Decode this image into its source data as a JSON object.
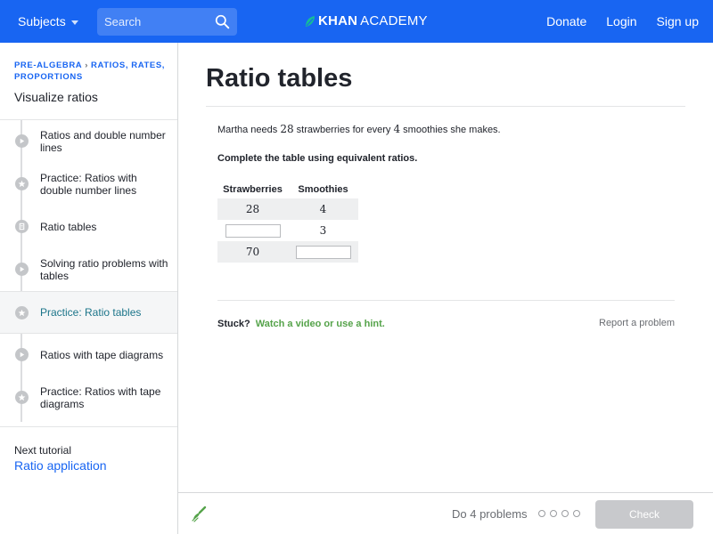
{
  "nav": {
    "subjects": "Subjects",
    "search_placeholder": "Search",
    "logo_bold": "KHAN",
    "logo_light": "ACADEMY",
    "donate": "Donate",
    "login": "Login",
    "signup": "Sign up",
    "bar_color": "#1865f2"
  },
  "sidebar": {
    "breadcrumb_1": "Pre-algebra",
    "breadcrumb_2": "Ratios, rates, proportions",
    "unit_title": "Visualize ratios",
    "items": [
      {
        "label": "Ratios and double number lines",
        "icon": "play-icon",
        "active": false
      },
      {
        "label": "Practice: Ratios with double number lines",
        "icon": "star-icon",
        "active": false
      },
      {
        "label": "Ratio tables",
        "icon": "article-icon",
        "active": false
      },
      {
        "label": "Solving ratio problems with tables",
        "icon": "play-icon",
        "active": false
      },
      {
        "label": "Practice: Ratio tables",
        "icon": "star-icon",
        "active": true
      },
      {
        "label": "Ratios with tape diagrams",
        "icon": "play-icon",
        "active": false
      },
      {
        "label": "Practice: Ratios with tape diagrams",
        "icon": "star-icon",
        "active": false
      }
    ],
    "next_label": "Next tutorial",
    "next_link": "Ratio application"
  },
  "main": {
    "title": "Ratio tables",
    "problem_pre": "Martha needs ",
    "problem_n1": "28",
    "problem_mid": " strawberries for every ",
    "problem_n2": "4",
    "problem_post": " smoothies she makes.",
    "instruction": "Complete the table using equivalent ratios.",
    "table": {
      "headers": [
        "Strawberries",
        "Smoothies"
      ],
      "rows": [
        [
          "28",
          "4"
        ],
        [
          "",
          "3"
        ],
        [
          "70",
          ""
        ]
      ]
    },
    "stuck": "Stuck?",
    "hint_link": "Watch a video or use a hint.",
    "report": "Report a problem"
  },
  "footer": {
    "do_problems": "Do 4 problems",
    "check": "Check"
  }
}
